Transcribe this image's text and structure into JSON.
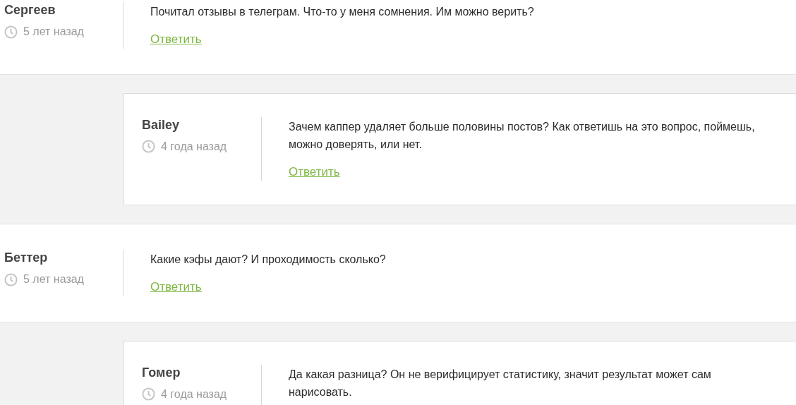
{
  "comments": [
    {
      "kind": "comment",
      "author": "Сергеев",
      "time": "5 лет назад",
      "text": "Почитал отзывы в телеграм. Что-то у меня сомнения. Им можно верить?",
      "reply_label": "Ответить"
    },
    {
      "kind": "reply",
      "author": "Bailey",
      "time": "4 года назад",
      "text": "Зачем каппер удаляет больше половины постов? Как ответишь на это вопрос, поймешь, можно доверять, или нет.",
      "reply_label": "Ответить"
    },
    {
      "kind": "comment",
      "author": "Беттер",
      "time": "5 лет назад",
      "text": "Какие кэфы дают? И проходимость сколько?",
      "reply_label": "Ответить"
    },
    {
      "kind": "reply",
      "author": "Гомер",
      "time": "4 года назад",
      "text": "Да какая разница? Он не верифицирует статистику, значит результат может сам нарисовать."
    }
  ]
}
